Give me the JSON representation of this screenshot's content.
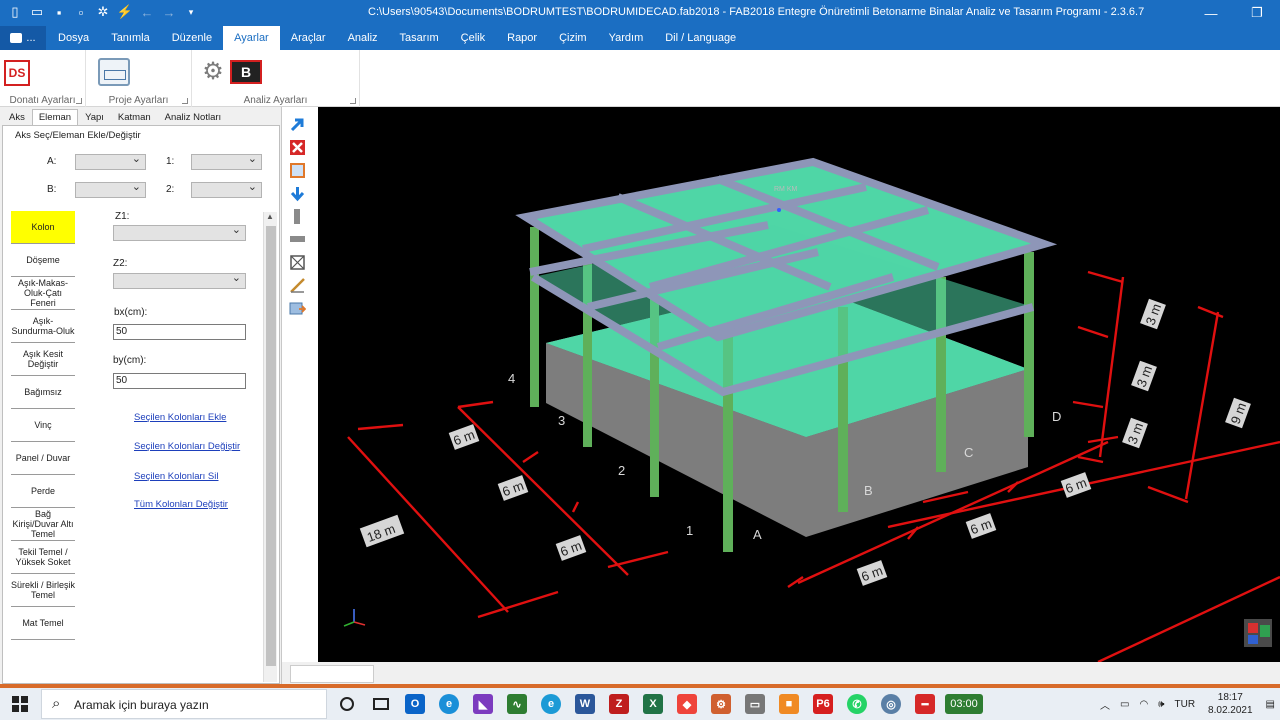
{
  "window": {
    "title": "C:\\Users\\90543\\Documents\\BODRUMTEST\\BODRUMIDECAD.fab2018 - FAB2018 Entegre Önüretimli Betonarme Binalar Analiz ve Tasarım Programı - 2.3.6.7"
  },
  "menu": {
    "app_label": "...",
    "items": [
      "Dosya",
      "Tanımla",
      "Düzenle",
      "Ayarlar",
      "Araçlar",
      "Analiz",
      "Tasarım",
      "Çelik",
      "Rapor",
      "Çizim",
      "Yardım",
      "Dil / Language"
    ],
    "active": "Ayarlar"
  },
  "ribbon": {
    "groups": [
      "Donatı Ayarları",
      "Proje Ayarları",
      "Analiz Ayarları"
    ],
    "ds_label": "DS",
    "b_label": "B"
  },
  "left_panel": {
    "tabs": [
      "Aks",
      "Eleman",
      "Yapı",
      "Katman",
      "Analiz Notları"
    ],
    "active_tab": "Eleman",
    "group_title": "Aks Seç/Eleman Ekle/Değiştir",
    "selectors": {
      "a": "A:",
      "one": "1:",
      "b": "B:",
      "two": "2:"
    },
    "element_buttons": [
      "Kolon",
      "Döşeme",
      "Aşık-Makas-Oluk-Çatı Feneri",
      "Aşık-Sundurma-Oluk",
      "Aşık Kesit Değiştir",
      "Bağımsız",
      "Vinç",
      "Panel / Duvar",
      "Perde",
      "Bağ Kirişi/Duvar Altı Temel",
      "Tekil Temel / Yüksek Soket",
      "Sürekli / Birleşik Temel",
      "Mat Temel"
    ],
    "active_element": "Kolon",
    "form": {
      "z1_label": "Z1:",
      "z2_label": "Z2:",
      "bx_label": "bx(cm):",
      "bx_value": "50",
      "by_label": "by(cm):",
      "by_value": "50",
      "links": [
        "Seçilen Kolonları Ekle",
        "Seçilen Kolonları Değiştir",
        "Seçilen Kolonları Sil",
        "Tüm Kolonları Değiştir"
      ]
    }
  },
  "viewport": {
    "dims": [
      "18 m",
      "6 m",
      "6 m",
      "6 m",
      "6 m",
      "6 m",
      "6 m",
      "3 m",
      "3 m",
      "3 m",
      "9 m"
    ],
    "axis_labels": [
      "1",
      "2",
      "3",
      "4",
      "A",
      "B",
      "C",
      "D"
    ],
    "marker": "RM KM",
    "colors": {
      "slab": "#4fd6a6",
      "beam": "#8e96b8",
      "column": "#5fb05a",
      "dimension": "#e01010",
      "base": "#7a7a7a"
    }
  },
  "taskbar": {
    "search_placeholder": "Aramak için buraya yazın",
    "apps": [
      "cortana",
      "task-view",
      "outlook",
      "edge",
      "visual-studio",
      "sway",
      "internet-explorer",
      "word",
      "filezilla",
      "excel",
      "anydesk",
      "settings",
      "printer",
      "app-orange",
      "primavera",
      "whatsapp",
      "network",
      "fab2018",
      "timer"
    ],
    "timer": "03:00",
    "language": "TUR",
    "time": "18:17",
    "date": "8.02.2021"
  }
}
